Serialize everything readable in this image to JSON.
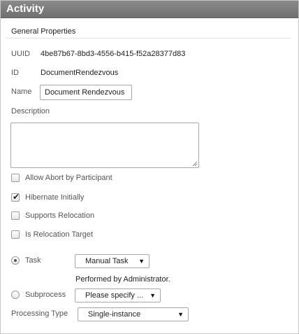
{
  "panel": {
    "title": "Activity"
  },
  "section": {
    "title": "General Properties"
  },
  "fields": {
    "uuid": {
      "label": "UUID",
      "value": "4be87b67-8bd3-4556-b415-f52a28377d83"
    },
    "id": {
      "label": "ID",
      "value": "DocumentRendezvous"
    },
    "name": {
      "label": "Name",
      "value": "Document Rendezvous"
    },
    "description": {
      "label": "Description",
      "value": ""
    }
  },
  "options": {
    "allow_abort": {
      "label": "Allow Abort by Participant",
      "checked": false
    },
    "hibernate": {
      "label": "Hibernate Initially",
      "checked": true
    },
    "supports_relocation": {
      "label": "Supports Relocation",
      "checked": false
    },
    "relocation_target": {
      "label": "Is Relocation Target",
      "checked": false
    }
  },
  "implementation": {
    "task": {
      "label": "Task",
      "selected": true,
      "dropdown_value": "Manual Task",
      "note": "Performed by Administrator."
    },
    "subprocess": {
      "label": "Subprocess",
      "selected": false,
      "dropdown_value": "Please specify ..."
    }
  },
  "processing_type": {
    "label": "Processing Type",
    "value": "Single-instance"
  },
  "icons": {
    "dropdown_arrow": "▼",
    "check_mark": "✔"
  },
  "colors": {
    "titlebar": "#7c7c7c",
    "title_text": "#ffffff",
    "border": "#c6c6c6"
  }
}
